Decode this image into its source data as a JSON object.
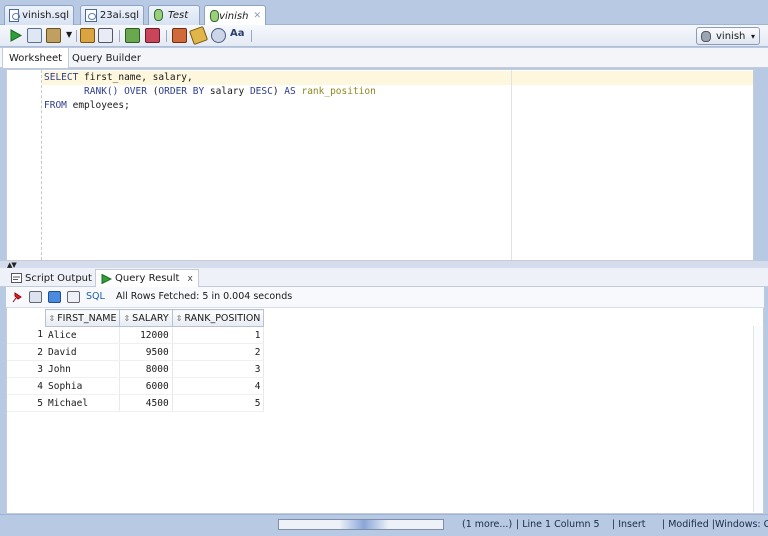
{
  "file_tabs": [
    {
      "label": "vinish.sql",
      "kind": "sql",
      "closable": false
    },
    {
      "label": "23ai.sql",
      "kind": "sql",
      "closable": false
    },
    {
      "label": "Test",
      "kind": "connection",
      "closable": false
    },
    {
      "label": "vinish",
      "kind": "connection",
      "closable": true
    }
  ],
  "toolbar": {
    "icons": [
      "run-statement-icon",
      "run-script-icon",
      "commit-icon",
      "rollback-icon",
      "find-icon",
      "autotrace-icon",
      "explain-plan-icon",
      "sql-tuning-icon",
      "clear-icon",
      "history-icon",
      "unshared-sql-icon",
      "format-icon"
    ],
    "connection_label": "vinish"
  },
  "subtabs": {
    "worksheet": "Worksheet",
    "query_builder": "Query Builder"
  },
  "editor": {
    "lines": [
      {
        "parts": [
          {
            "t": "SELECT",
            "c": "kw"
          },
          {
            "t": " first_name, salary,",
            "c": ""
          }
        ]
      },
      {
        "parts": [
          {
            "t": "       RANK() ",
            "c": "kw"
          },
          {
            "t": "OVER",
            "c": "kw"
          },
          {
            "t": " (",
            "c": ""
          },
          {
            "t": "ORDER BY",
            "c": "kw"
          },
          {
            "t": " salary ",
            "c": ""
          },
          {
            "t": "DESC",
            "c": "kw"
          },
          {
            "t": ") ",
            "c": ""
          },
          {
            "t": "AS",
            "c": "kw"
          },
          {
            "t": " ",
            "c": ""
          },
          {
            "t": "rank_position",
            "c": "al"
          }
        ]
      },
      {
        "parts": [
          {
            "t": "FROM",
            "c": "kw"
          },
          {
            "t": " employees;",
            "c": ""
          }
        ]
      }
    ]
  },
  "output_tabs": {
    "script_output": "Script Output",
    "query_result": "Query Result"
  },
  "result": {
    "sql_link": "SQL",
    "status": "All Rows Fetched: 5 in 0.004 seconds",
    "columns": [
      "FIRST_NAME",
      "SALARY",
      "RANK_POSITION"
    ],
    "rows": [
      {
        "n": "1",
        "first_name": "Alice",
        "salary": "12000",
        "rank": "1"
      },
      {
        "n": "2",
        "first_name": "David",
        "salary": "9500",
        "rank": "2"
      },
      {
        "n": "3",
        "first_name": "John",
        "salary": "8000",
        "rank": "3"
      },
      {
        "n": "4",
        "first_name": "Sophia",
        "salary": "6000",
        "rank": "4"
      },
      {
        "n": "5",
        "first_name": "Michael",
        "salary": "4500",
        "rank": "5"
      }
    ]
  },
  "statusbar": {
    "more": "(1 more...)",
    "position": "| Line 1 Column 5",
    "mode": "| Insert",
    "modified": "| Modified |",
    "os": "Windows: Cr"
  },
  "colors": {
    "keyword": "#2d3d8f",
    "alias": "#8d8a1c",
    "current_line": "#fdf7de",
    "chrome": "#b8c9e3"
  }
}
